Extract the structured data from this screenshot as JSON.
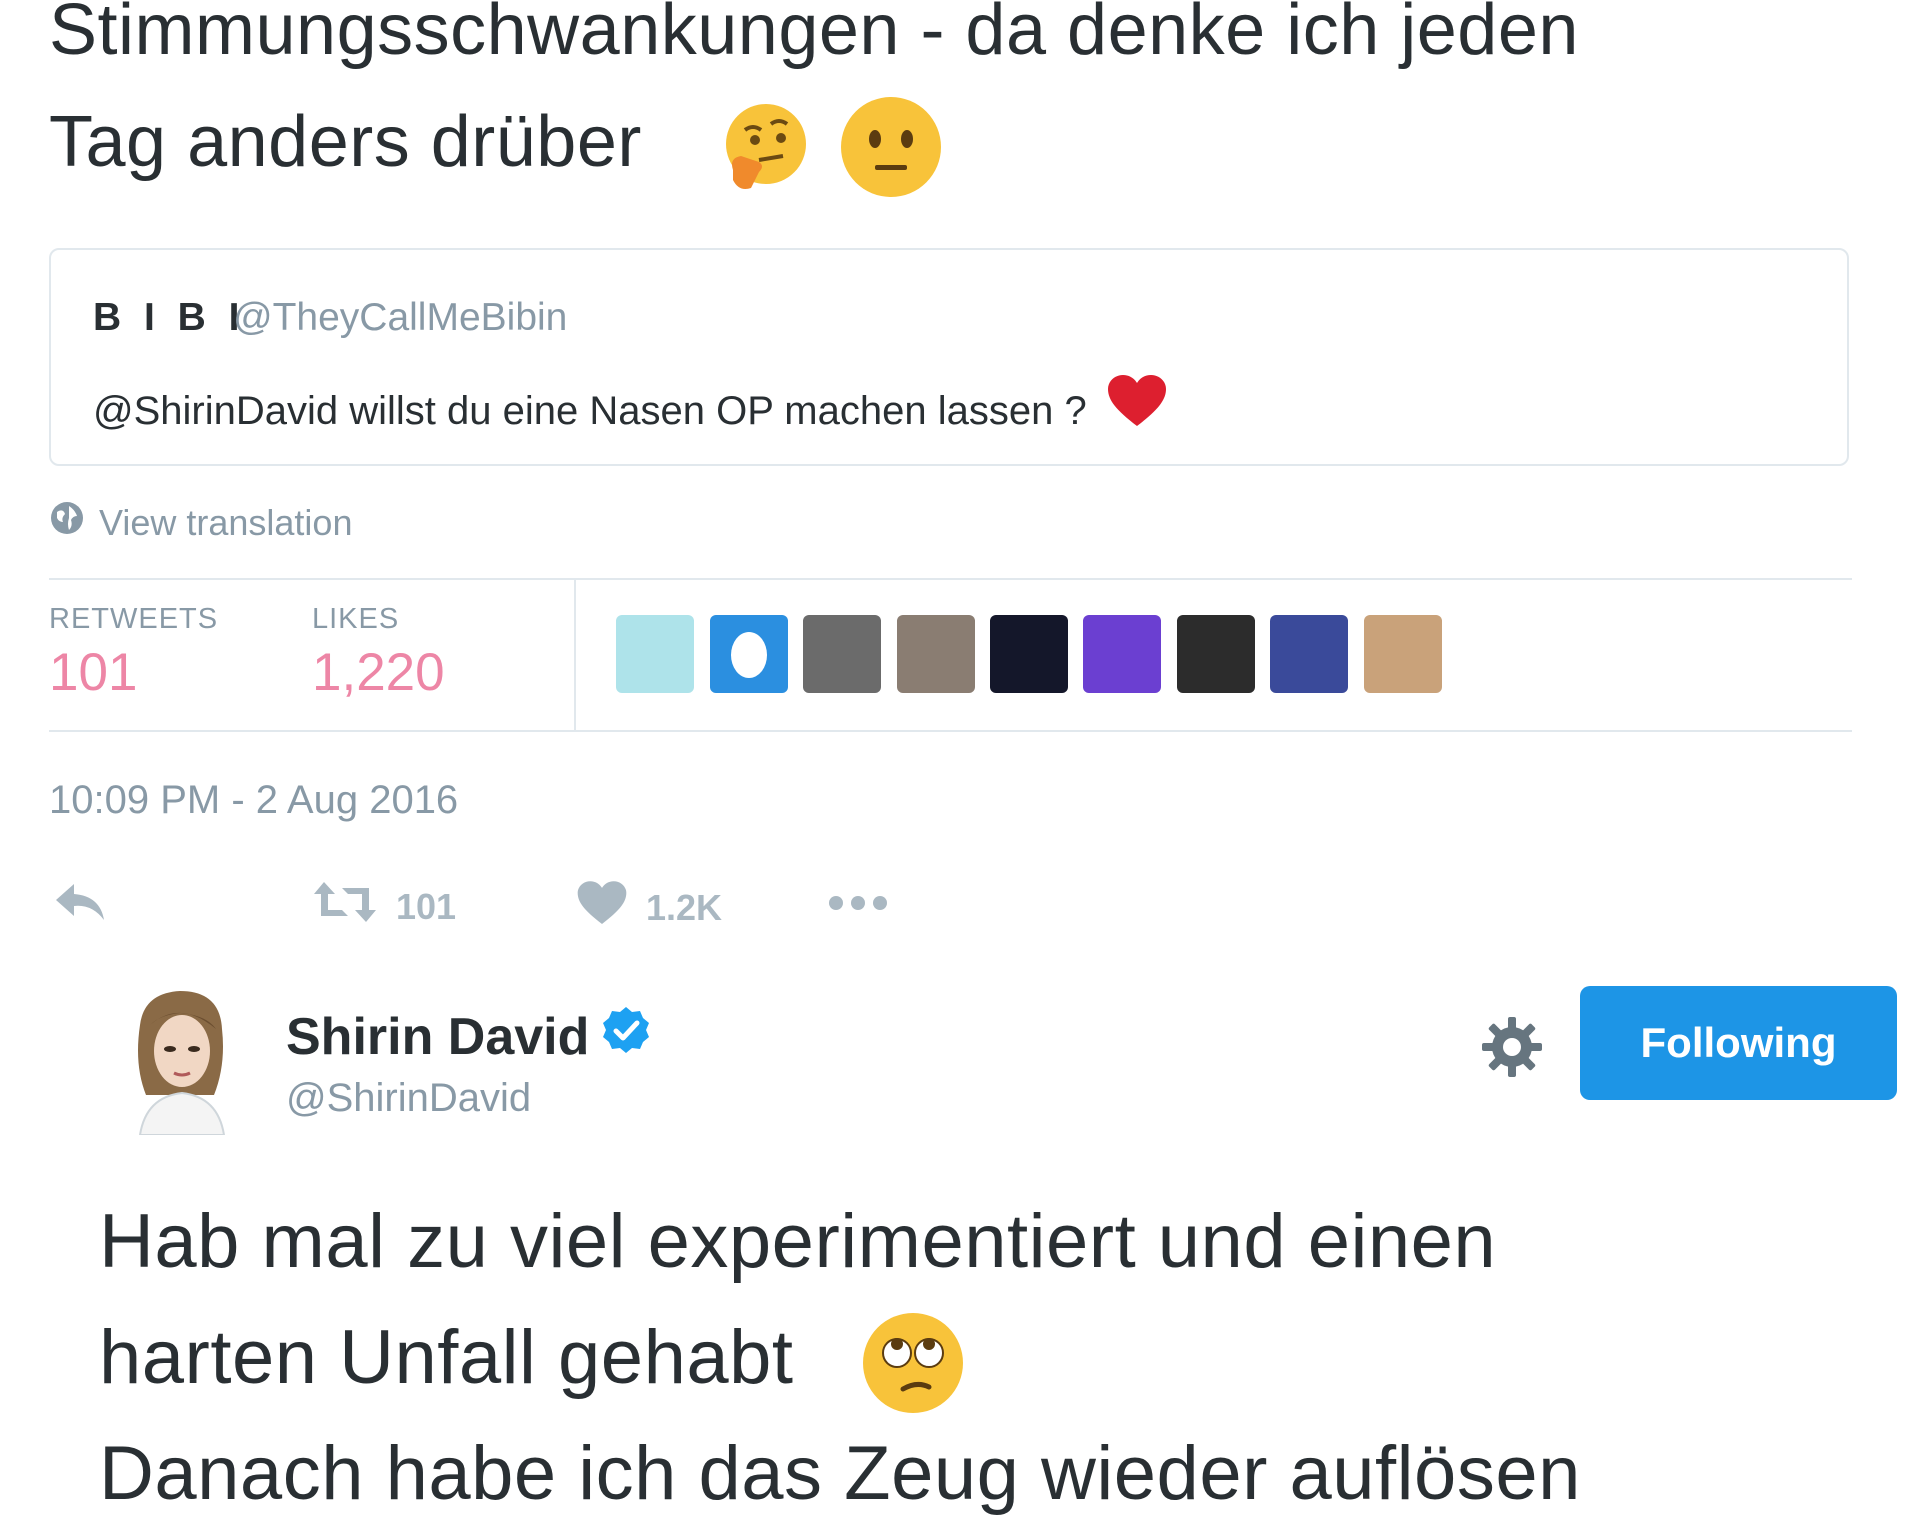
{
  "tweet1": {
    "text_line1": "Stimmungsschwankungen - da denke ich jeden",
    "text_line2": "Tag anders drüber",
    "emojis": [
      "thinking-face",
      "neutral-face"
    ],
    "quote": {
      "name": "B I B I",
      "handle": "@TheyCallMeBibin",
      "text": "@ShirinDavid willst du eine Nasen OP machen lassen ?",
      "emoji": "red-heart"
    },
    "view_translation": "View translation",
    "stats": {
      "retweets_label": "RETWEETS",
      "retweets_value": "101",
      "likes_label": "LIKES",
      "likes_value": "1,220"
    },
    "likers": [
      {
        "color": "#aee3ea"
      },
      {
        "color": "#2b8fe0"
      },
      {
        "color": "#6b6b6b"
      },
      {
        "color": "#8a7d72"
      },
      {
        "color": "#14172a"
      },
      {
        "color": "#6b3fd1"
      },
      {
        "color": "#2c2c2c"
      },
      {
        "color": "#3a4a9a"
      },
      {
        "color": "#c9a27a"
      }
    ],
    "timestamp": "10:09 PM - 2 Aug 2016",
    "actions": {
      "retweet_count": "101",
      "like_count": "1.2K"
    }
  },
  "tweet2": {
    "author_name": "Shirin David",
    "author_handle": "@ShirinDavid",
    "follow_label": "Following",
    "text_line1": "Hab mal zu viel experimentiert und einen",
    "text_line2": "harten Unfall gehabt",
    "text_line3": "Danach habe ich das Zeug wieder auflösen",
    "emoji": "face-with-rolling-eyes"
  },
  "colors": {
    "accent": "#1d95e6",
    "like": "#e0245e",
    "muted": "#8899a6",
    "border": "#e1e8ed",
    "verified": "#1da1f2"
  }
}
